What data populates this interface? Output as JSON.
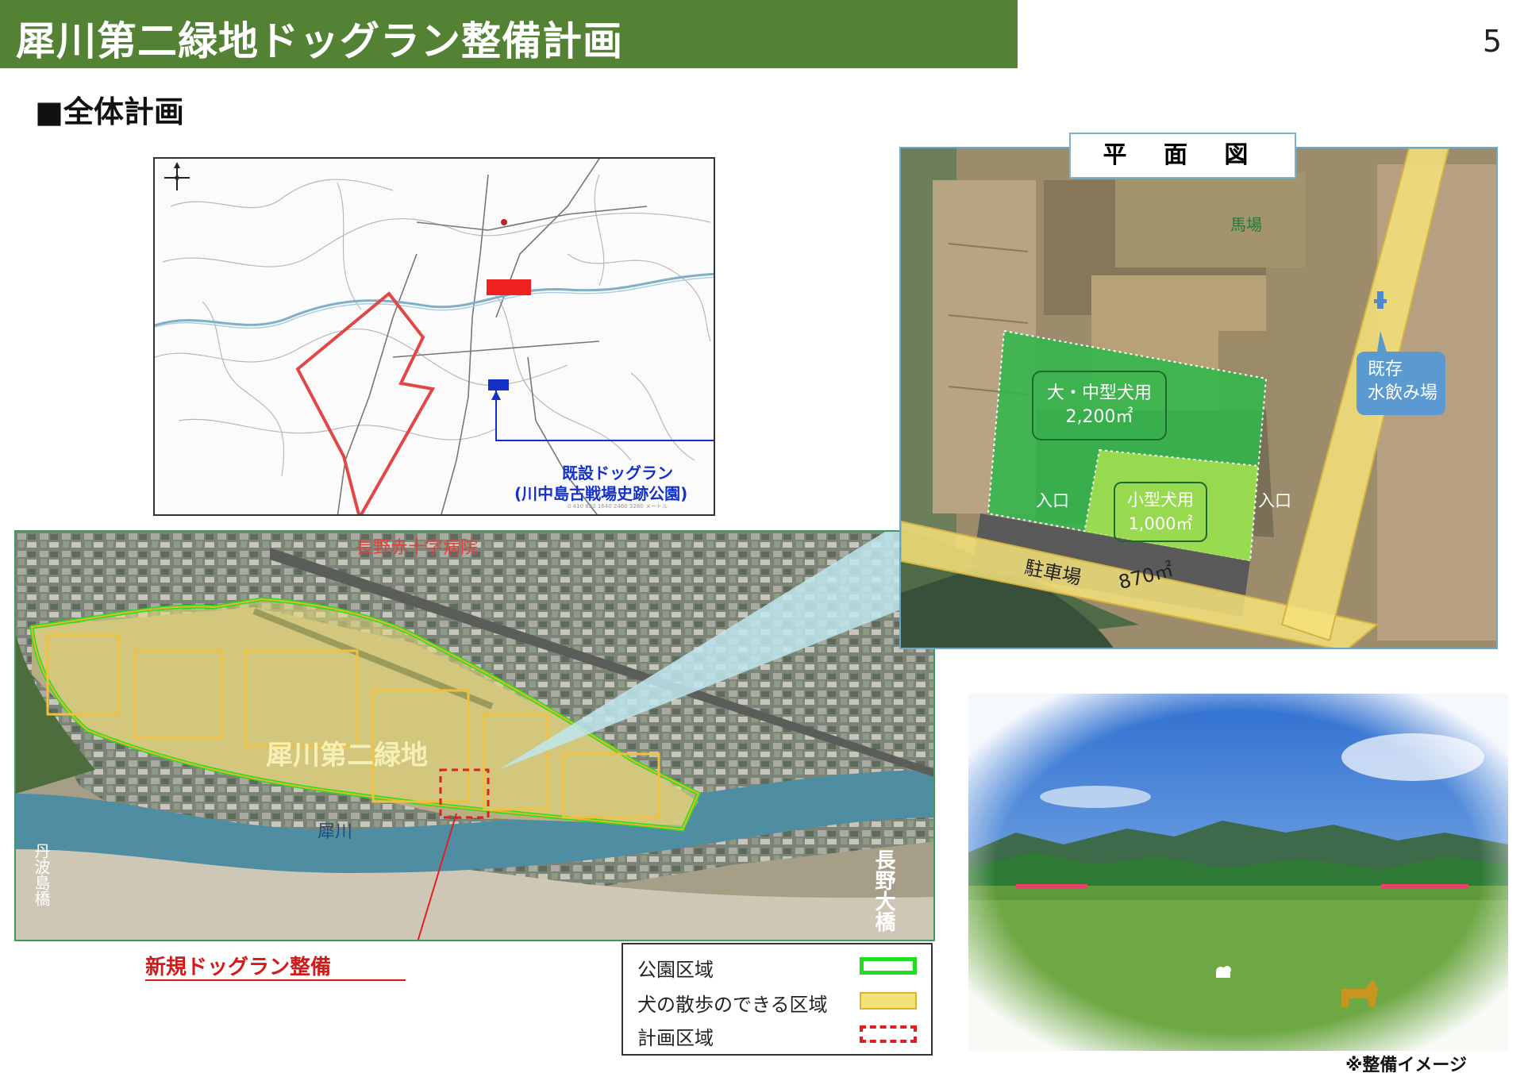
{
  "header": {
    "title": "犀川第二緑地ドッグラン整備計画",
    "page_number": "5",
    "bar_color": "#548235"
  },
  "section": {
    "heading": "■全体計画"
  },
  "location_map": {
    "existing_dogrun_label": "既設ドッグラン",
    "existing_dogrun_sub": "(川中島古戦場史跡公園)"
  },
  "aerial": {
    "hospital_label": "長野赤十字病院",
    "park_label": "犀川第二緑地",
    "river_label": "犀川",
    "bridge_left": "丹波島橋",
    "bridge_right": "長野大橋",
    "new_dogrun_label": "新規ドッグラン整備"
  },
  "plan": {
    "title": "平 面 図",
    "horse_field": "馬場",
    "large_dog_label": "大・中型犬用",
    "large_dog_area": "2,200㎡",
    "small_dog_label": "小型犬用",
    "small_dog_area": "1,000㎡",
    "entrance_left": "入口",
    "entrance_right": "入口",
    "parking_label": "駐車場",
    "parking_area": "870㎡",
    "water_label_1": "既存",
    "water_label_2": "水飲み場"
  },
  "legend": {
    "items": [
      {
        "label": "公園区域",
        "color": "#22dd22"
      },
      {
        "label": "犬の散歩のできる区域",
        "color": "#f2e27a"
      },
      {
        "label": "計画区域",
        "color": "#e02020"
      }
    ]
  },
  "photo": {
    "caption": "※整備イメージ"
  }
}
